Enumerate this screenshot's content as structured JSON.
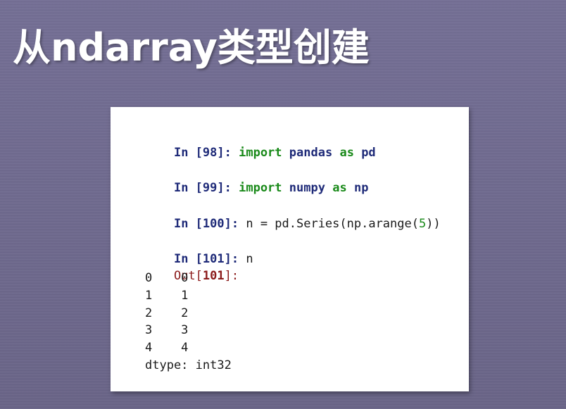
{
  "slide": {
    "title": "从ndarray类型创建"
  },
  "cells": [
    {
      "in_label": "In [",
      "in_num": "98",
      "in_close": "]: ",
      "tokens": [
        "import",
        " ",
        "pandas",
        " ",
        "as",
        " ",
        "pd"
      ]
    },
    {
      "in_label": "In [",
      "in_num": "99",
      "in_close": "]: ",
      "tokens": [
        "import",
        " ",
        "numpy",
        " ",
        "as",
        " ",
        "np"
      ]
    },
    {
      "in_label": "In [",
      "in_num": "100",
      "in_close": "]: ",
      "code_before": "n = pd.Series(np.arange(",
      "code_arg": "5",
      "code_after": "))"
    },
    {
      "in_label": "In [",
      "in_num": "101",
      "in_close": "]: ",
      "code": "n"
    }
  ],
  "output": {
    "out_label": "Out[",
    "out_num": "101",
    "out_close": "]:",
    "rows": [
      "0    0",
      "1    1",
      "2    2",
      "3    3",
      "4    4"
    ],
    "dtype": "dtype: int32"
  }
}
